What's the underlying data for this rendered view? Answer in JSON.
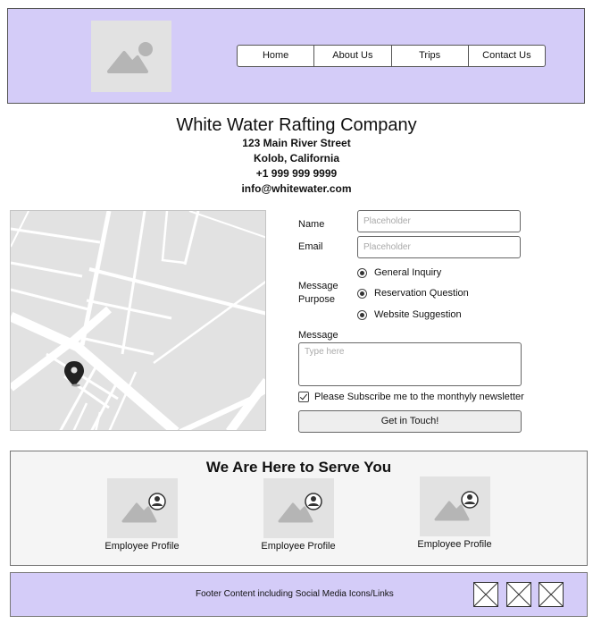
{
  "nav": {
    "items": [
      {
        "label": "Home"
      },
      {
        "label": "About Us"
      },
      {
        "label": "Trips"
      },
      {
        "label": "Contact Us"
      }
    ]
  },
  "company": {
    "name": "White Water Rafting Company",
    "address_line1": "123 Main River Street",
    "address_line2": "Kolob, California",
    "phone": "+1 999 999 9999",
    "email": "info@whitewater.com"
  },
  "form": {
    "name_label": "Name",
    "name_placeholder": "Placeholder",
    "email_label": "Email",
    "email_placeholder": "Placeholder",
    "purpose_label_line1": "Message",
    "purpose_label_line2": "Purpose",
    "purpose_options": [
      {
        "label": "General Inquiry"
      },
      {
        "label": "Reservation Question"
      },
      {
        "label": "Website Suggestion"
      }
    ],
    "message_label": "Message",
    "message_placeholder": "Type here",
    "newsletter_label": "Please Subscribe me to the monthyly newsletter",
    "newsletter_checked": true,
    "submit_label": "Get in Touch!"
  },
  "serve": {
    "title": "We Are Here to Serve You",
    "profiles": [
      {
        "label": "Employee Profile"
      },
      {
        "label": "Employee Profile"
      },
      {
        "label": "Employee Profile"
      }
    ]
  },
  "footer": {
    "text": "Footer Content including Social Media Icons/Links",
    "social_icons": [
      "social-link-placeholder",
      "social-link-placeholder",
      "social-link-placeholder"
    ]
  },
  "colors": {
    "header_bg": "#d4ccf8",
    "placeholder_gray": "#e2e2e2"
  }
}
